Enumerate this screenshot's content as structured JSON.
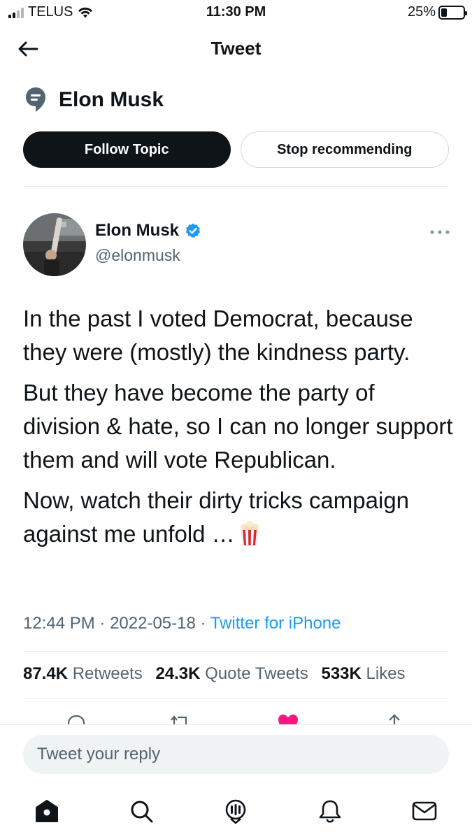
{
  "status_bar": {
    "carrier": "TELUS",
    "time": "11:30 PM",
    "battery": "25%",
    "battery_level": 0.25,
    "signal_bars": 2,
    "signal_icon": "signal-icon",
    "wifi_icon": "wifi-icon"
  },
  "header": {
    "title": "Tweet",
    "back_icon": "back-arrow-icon"
  },
  "topic": {
    "icon": "topic-icon",
    "title": "Elon Musk",
    "follow_label": "Follow Topic",
    "stop_label": "Stop recommending"
  },
  "tweet": {
    "author_name": "Elon Musk",
    "handle": "@elonmusk",
    "verified": true,
    "paragraphs": [
      "In the past I voted Democrat, because they were (mostly) the kindness party.",
      "But they have become the party of division & hate, so I can no longer support them and will vote Republican.",
      "Now, watch their dirty tricks campaign against me unfold …"
    ],
    "emoji_icon": "popcorn-icon",
    "time": "12:44 PM",
    "date": "2022-05-18",
    "separator": "·",
    "source": "Twitter for iPhone",
    "stats": {
      "retweets_count": "87.4K",
      "retweets_label": "Retweets",
      "quotes_count": "24.3K",
      "quotes_label": "Quote Tweets",
      "likes_count": "533K",
      "likes_label": "Likes"
    }
  },
  "reply": {
    "placeholder": "Tweet your reply"
  },
  "colors": {
    "text": "#0f1419",
    "secondary": "#536471",
    "accent": "#1d9bf0",
    "like": "#f91880"
  },
  "tabbar": {
    "items": [
      "home-icon",
      "search-icon",
      "spaces-icon",
      "notifications-icon",
      "messages-icon"
    ]
  }
}
